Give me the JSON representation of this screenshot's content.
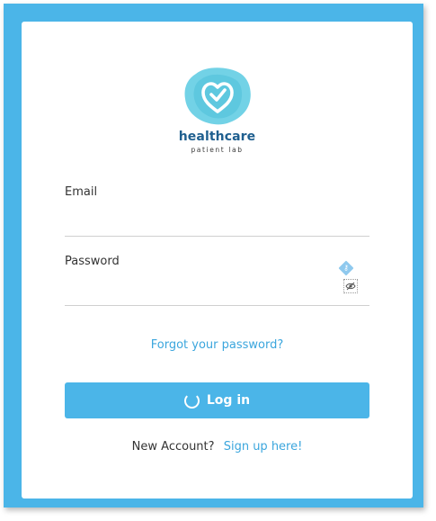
{
  "brand": {
    "name": "healthcare",
    "tagline": "patient lab",
    "logo_icon": "heart-check-icon",
    "primary_color": "#4bb5e8",
    "brand_text_color": "#1f5f8f"
  },
  "form": {
    "email_label": "Email",
    "email_value": "",
    "password_label": "Password",
    "password_value": "",
    "password_key_icon": "key-badge-icon",
    "password_toggle_icon": "eye-slash-icon"
  },
  "links": {
    "forgot_password": "Forgot your password?",
    "new_account_text": "New Account?",
    "signup": "Sign up here!"
  },
  "actions": {
    "login_label": "Log in",
    "login_state_icon": "loading-spinner-icon"
  }
}
